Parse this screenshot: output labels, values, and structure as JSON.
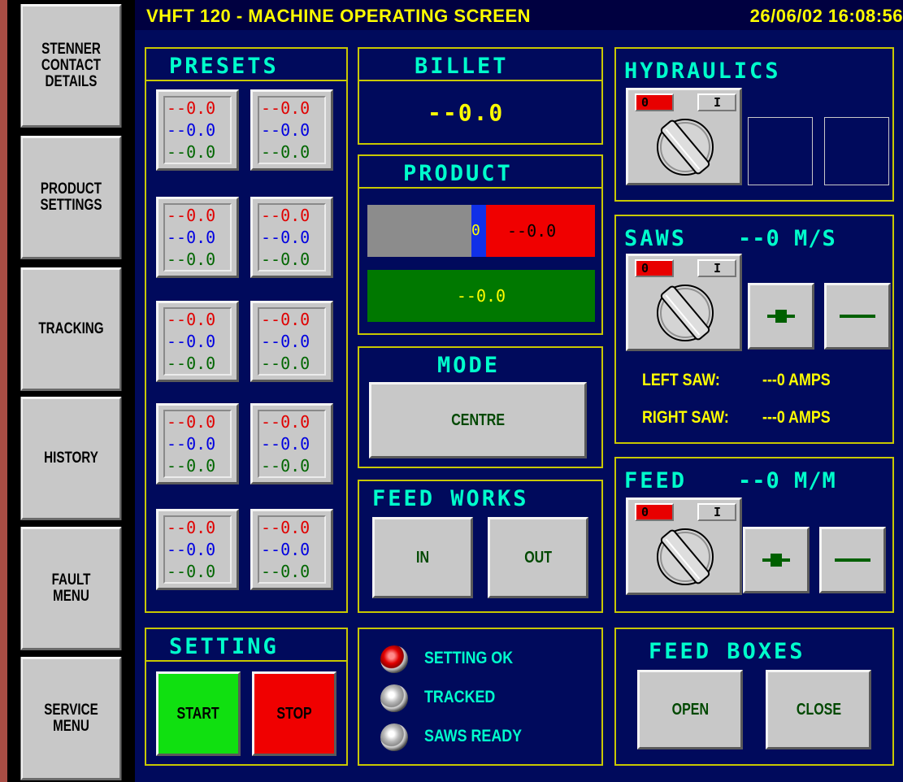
{
  "window": {
    "title": "VHFT 120 - MACHINE OPERATING SCREEN",
    "datetime": "26/06/02 16:08:56"
  },
  "sidebar": {
    "items": [
      {
        "label": "STENNER\nCONTACT\nDETAILS"
      },
      {
        "label": "PRODUCT\nSETTINGS"
      },
      {
        "label": "TRACKING"
      },
      {
        "label": "HISTORY"
      },
      {
        "label": "FAULT\nMENU"
      },
      {
        "label": "SERVICE\nMENU"
      }
    ]
  },
  "presets": {
    "title": "PRESETS",
    "tiles": [
      {
        "red": "--0.0",
        "blue": "--0.0",
        "green": "--0.0"
      },
      {
        "red": "--0.0",
        "blue": "--0.0",
        "green": "--0.0"
      },
      {
        "red": "--0.0",
        "blue": "--0.0",
        "green": "--0.0"
      },
      {
        "red": "--0.0",
        "blue": "--0.0",
        "green": "--0.0"
      },
      {
        "red": "--0.0",
        "blue": "--0.0",
        "green": "--0.0"
      },
      {
        "red": "--0.0",
        "blue": "--0.0",
        "green": "--0.0"
      },
      {
        "red": "--0.0",
        "blue": "--0.0",
        "green": "--0.0"
      },
      {
        "red": "--0.0",
        "blue": "--0.0",
        "green": "--0.0"
      },
      {
        "red": "--0.0",
        "blue": "--0.0",
        "green": "--0.0"
      },
      {
        "red": "--0.0",
        "blue": "--0.0",
        "green": "--0.0"
      }
    ]
  },
  "billet": {
    "title": "BILLET",
    "value": "--0.0"
  },
  "product": {
    "title": "PRODUCT",
    "blue_value": "0",
    "red_value": "--0.0",
    "green_value": "--0.0"
  },
  "mode": {
    "title": "MODE",
    "button_label": "CENTRE"
  },
  "feed_works": {
    "title": "FEED WORKS",
    "in_label": "IN",
    "out_label": "OUT"
  },
  "setting": {
    "title": "SETTING",
    "start_label": "START",
    "stop_label": "STOP"
  },
  "status": {
    "items": [
      {
        "label": "SETTING OK",
        "state": "red"
      },
      {
        "label": "TRACKED",
        "state": "grey"
      },
      {
        "label": "SAWS READY",
        "state": "grey"
      }
    ]
  },
  "hydraulics": {
    "title": "HYDRAULICS",
    "off_label": "0",
    "on_label": "I"
  },
  "saws": {
    "title": "SAWS",
    "speed": "--0 M/S",
    "off_label": "0",
    "on_label": "I",
    "plus_icon": "plus-icon",
    "minus_icon": "minus-icon",
    "left_label": "LEFT SAW:",
    "left_value": "---0 AMPS",
    "right_label": "RIGHT SAW:",
    "right_value": "---0 AMPS"
  },
  "feed": {
    "title": "FEED",
    "speed": "--0 M/M",
    "off_label": "0",
    "on_label": "I"
  },
  "feed_boxes": {
    "title": "FEED BOXES",
    "open_label": "OPEN",
    "close_label": "CLOSE"
  },
  "colors": {
    "screen_bg": "#000a5c",
    "frame": "#a84d44",
    "panel_border": "#c8c800",
    "title_text": "#00ffcc",
    "title_bar_text": "#ffff00",
    "button_text": "#004800"
  }
}
